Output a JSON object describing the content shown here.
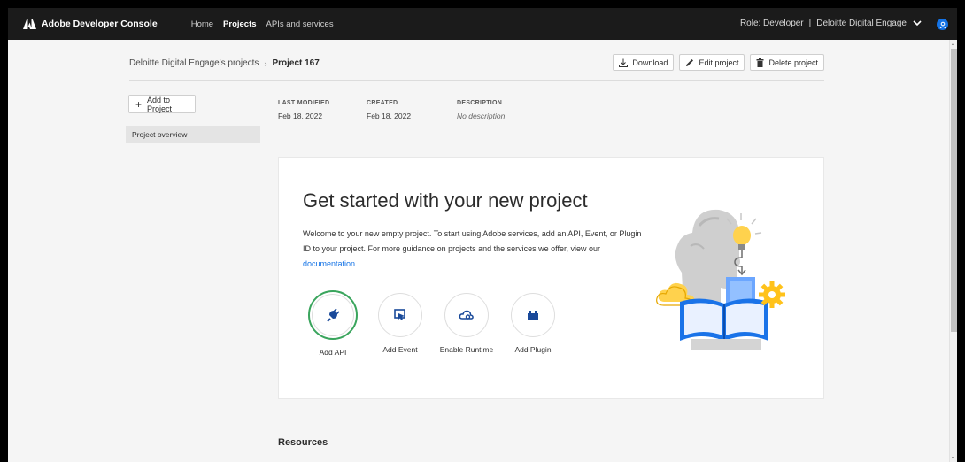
{
  "app": {
    "title": "Adobe Developer Console",
    "nav": [
      "Home",
      "Projects",
      "APIs and services"
    ],
    "role_label": "Role: Developer",
    "org": "Deloitte Digital Engage"
  },
  "breadcrumb": {
    "parent": "Deloitte Digital Engage's projects",
    "current": "Project 167"
  },
  "actions": {
    "download": "Download",
    "edit": "Edit project",
    "delete": "Delete project"
  },
  "sidebar": {
    "add_label": "Add to Project",
    "items": [
      "Project overview"
    ]
  },
  "meta": {
    "last_modified_label": "LAST MODIFIED",
    "last_modified": "Feb 18, 2022",
    "created_label": "CREATED",
    "created": "Feb 18, 2022",
    "description_label": "DESCRIPTION",
    "description": "No description"
  },
  "card": {
    "title": "Get started with your new project",
    "desc_pre": "Welcome to your new empty project. To start using Adobe services, add an API, Event, or Plugin ID to your project. For more guidance on projects and the services we offer, view our ",
    "desc_link": "documentation",
    "desc_post": ".",
    "services": [
      {
        "label": "Add API",
        "icon": "plug-icon"
      },
      {
        "label": "Add Event",
        "icon": "event-icon"
      },
      {
        "label": "Enable Runtime",
        "icon": "runtime-cloud-icon"
      },
      {
        "label": "Add Plugin",
        "icon": "plugin-icon"
      }
    ]
  },
  "resources_title": "Resources",
  "colors": {
    "accent": "#1473e6",
    "selected_ring": "#3aa55d",
    "topbar": "#1b1b1b"
  }
}
